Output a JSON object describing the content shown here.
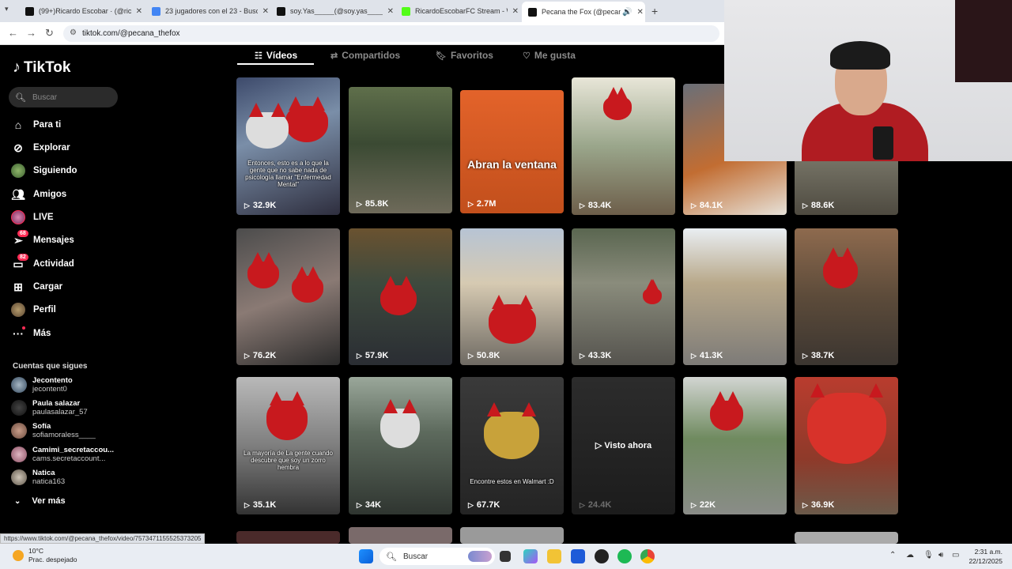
{
  "browser": {
    "tabs": [
      {
        "title": "(99+)Ricardo Escobar · (@ric",
        "color": "#111111"
      },
      {
        "title": "23 jugadores con el 23 - Busca",
        "color": "#4285f4"
      },
      {
        "title": "soy.Yas_____(@soy.yas_____) |",
        "color": "#111111"
      },
      {
        "title": "RicardoEscobarFC Stream - Wa",
        "color": "#53fc18"
      },
      {
        "title": "Pecana the Fox (@pecana_t",
        "color": "#111111"
      }
    ],
    "url": "tiktok.com/@pecana_thefox",
    "status_link": "https://www.tiktok.com/@pecana_thefox/video/7573471155525373205"
  },
  "sidebar": {
    "logo": "TikTok",
    "search_placeholder": "Buscar",
    "nav": [
      {
        "label": "Para ti",
        "icon": "home-icon"
      },
      {
        "label": "Explorar",
        "icon": "compass-icon"
      },
      {
        "label": "Siguiendo",
        "icon": "following-avatar"
      },
      {
        "label": "Amigos",
        "icon": "friends-icon"
      },
      {
        "label": "LIVE",
        "icon": "live-avatar"
      },
      {
        "label": "Mensajes",
        "icon": "messages-icon",
        "badge": "68"
      },
      {
        "label": "Actividad",
        "icon": "activity-icon",
        "badge": "82"
      },
      {
        "label": "Cargar",
        "icon": "upload-icon"
      },
      {
        "label": "Perfil",
        "icon": "profile-avatar"
      },
      {
        "label": "Más",
        "icon": "more-icon"
      }
    ],
    "following_title": "Cuentas que sigues",
    "following": [
      {
        "name": "Jecontento",
        "handle": "jecontent0"
      },
      {
        "name": "Paula salazar",
        "handle": "paulasalazar_57"
      },
      {
        "name": "Sofía",
        "handle": "sofiamoraless____"
      },
      {
        "name": "Camimi_secretaccou...",
        "handle": "cams.secretaccount..."
      },
      {
        "name": "Natica",
        "handle": "natica163"
      }
    ],
    "see_more": "Ver más"
  },
  "profile_tabs": [
    "Vídeos",
    "Compartidos",
    "Favoritos",
    "Me gusta"
  ],
  "videos": [
    {
      "views": "32.9K",
      "caption": "Entonces, esto es a lo que la gente que no sabe nada de psicología llamar \"Enfermedad Mental\""
    },
    {
      "views": "85.8K"
    },
    {
      "views": "2.7M",
      "big_text": "Abran la ventana"
    },
    {
      "views": "83.4K"
    },
    {
      "views": "84.1K"
    },
    {
      "views": "88.6K"
    },
    {
      "views": "76.2K"
    },
    {
      "views": "57.9K"
    },
    {
      "views": "50.8K"
    },
    {
      "views": "43.3K"
    },
    {
      "views": "41.3K"
    },
    {
      "views": "38.7K"
    },
    {
      "views": "35.1K",
      "caption": "La mayoría de La gente cuando descubre que soy un zorro hembra"
    },
    {
      "views": "34K"
    },
    {
      "views": "67.7K",
      "caption": "Encontre estos en Walmart :D"
    },
    {
      "views": "24.4K",
      "watched": "Visto ahora"
    },
    {
      "views": "22K"
    },
    {
      "views": "36.9K"
    }
  ],
  "taskbar": {
    "weather_temp": "10°C",
    "weather_desc": "Prac. despejado",
    "search_placeholder": "Buscar",
    "time": "2:31 a.m.",
    "date": "22/12/2025"
  }
}
